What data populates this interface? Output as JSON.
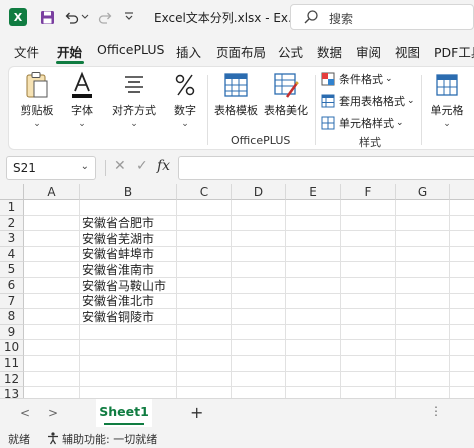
{
  "window": {
    "app_logo": "X",
    "title": "Excel文本分列.xlsx  -  Ex…",
    "search_placeholder": "搜索",
    "quick_access": [
      "save-icon",
      "undo-icon",
      "undo-dropdown-icon",
      "redo-icon",
      "more-icon"
    ]
  },
  "ribbon_tabs": [
    "文件",
    "开始",
    "OfficePLUS",
    "插入",
    "页面布局",
    "公式",
    "数据",
    "审阅",
    "视图",
    "PDF工具"
  ],
  "active_tab": "开始",
  "ribbon": {
    "clipboard": "剪贴板",
    "font": "字体",
    "alignment": "对齐方式",
    "number": "数字",
    "table_template": "表格模板",
    "table_beautify": "表格美化",
    "officeplus_group": "OfficePLUS",
    "conditional_format": "条件格式",
    "format_as_table": "套用表格格式",
    "cell_styles": "单元格样式",
    "styles_group": "样式",
    "cells": "单元格"
  },
  "formula_bar": {
    "name_box": "S21",
    "cancel": "✕",
    "confirm": "✓",
    "fx": "fx",
    "value": ""
  },
  "grid": {
    "columns": [
      "A",
      "B",
      "C",
      "D",
      "E",
      "F",
      "G"
    ],
    "rows": [
      "1",
      "2",
      "3",
      "4",
      "5",
      "6",
      "7",
      "8",
      "9",
      "10",
      "11",
      "12",
      "13"
    ],
    "column_b_values": [
      "安徽省合肥市",
      "安徽省芜湖市",
      "安徽省蚌埠市",
      "安徽省淮南市",
      "安徽省马鞍山市",
      "安徽省淮北市",
      "安徽省铜陵市"
    ]
  },
  "sheets": {
    "prev": "<",
    "next": ">",
    "active": "Sheet1",
    "add": "+",
    "more": "⋮"
  },
  "status": {
    "ready": "就绪",
    "accessibility": "辅助功能: 一切就绪"
  },
  "colors": {
    "accent": "#107c41",
    "chrome": "#f3f3f3"
  }
}
